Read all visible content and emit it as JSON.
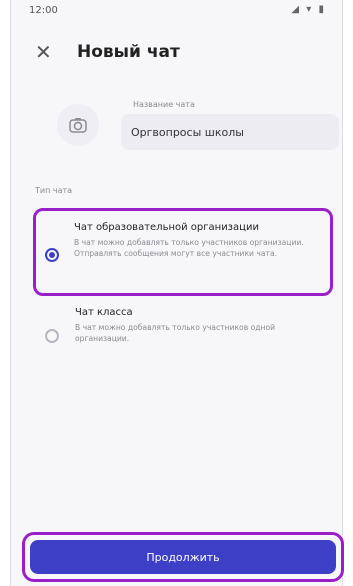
{
  "status_bar": {
    "time": "12:00",
    "icons": "◢ ▾ ▮"
  },
  "header": {
    "title": "Новый чат"
  },
  "chat_name": {
    "label": "Название чата",
    "value": "Оргвопросы школы"
  },
  "section": {
    "label": "Тип чата"
  },
  "options": [
    {
      "title": "Чат образовательной организации",
      "description": "В чат можно добавлять только участников организации. Отправлять сообщения могут все участники чата.",
      "selected": true
    },
    {
      "title": "Чат класса",
      "description": "В чат можно добавлять только участников одной организации.",
      "selected": false
    }
  ],
  "actions": {
    "continue_label": "Продолжить"
  },
  "colors": {
    "accent": "#3d3fc6",
    "highlight": "#9b1fc9"
  }
}
